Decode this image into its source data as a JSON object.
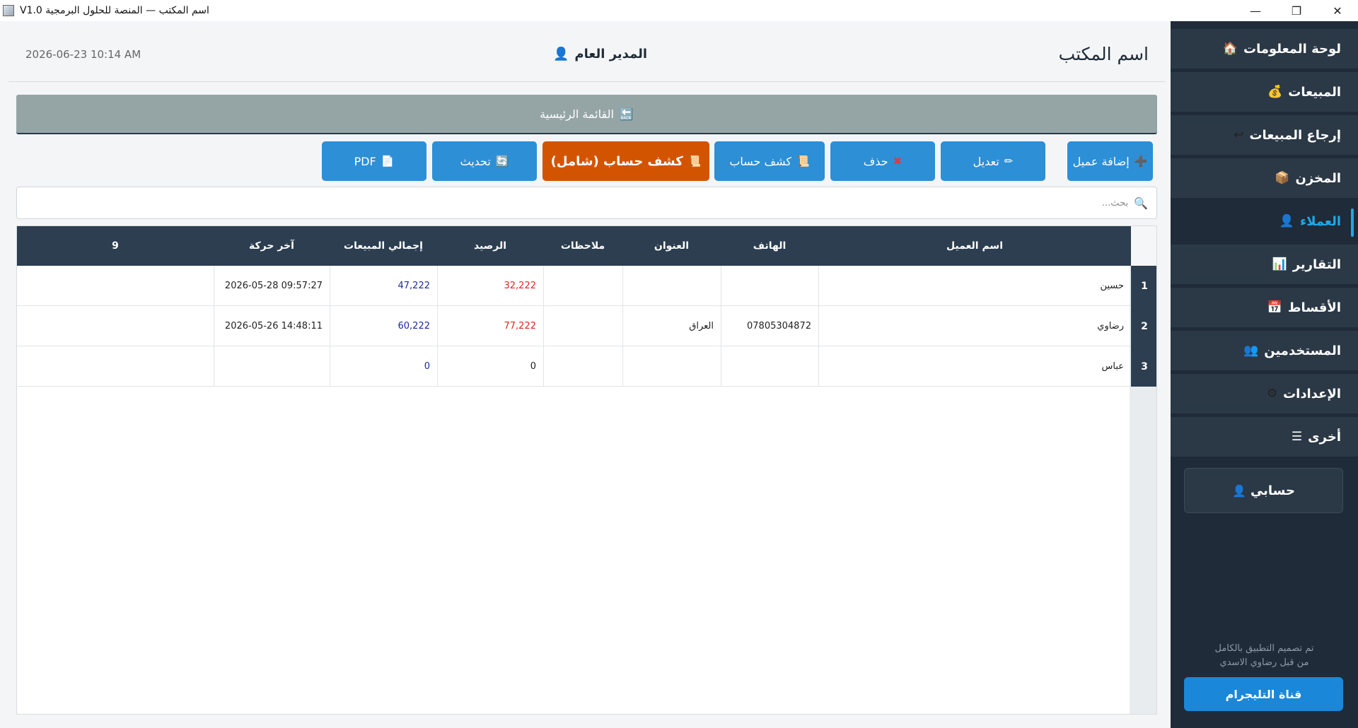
{
  "window": {
    "title": "V1.0 اسم المكتب — المنصة للحلول البرمجية",
    "minimize": "—",
    "maximize": "❐",
    "close": "✕"
  },
  "header": {
    "office_name": "اسم المكتب",
    "manager": "المدير العام",
    "manager_icon": "👤",
    "datetime": "2026-06-23  10:14 AM"
  },
  "sidebar": {
    "items": [
      {
        "label": "لوحة المعلومات",
        "icon": "🏠"
      },
      {
        "label": "المبيعات",
        "icon": "💰"
      },
      {
        "label": "إرجاع المبيعات",
        "icon": "↩"
      },
      {
        "label": "المخزن",
        "icon": "📦"
      },
      {
        "label": "العملاء",
        "icon": "👤"
      },
      {
        "label": "التقارير",
        "icon": "📊"
      },
      {
        "label": "الأقساط",
        "icon": "📅"
      },
      {
        "label": "المستخدمين",
        "icon": "👥"
      },
      {
        "label": "الإعدادات",
        "icon": "⚙"
      },
      {
        "label": "أخرى",
        "icon": "☰"
      }
    ],
    "my_account": "حسابي",
    "my_account_icon": "👤",
    "credit_line1": "تم تصميم التطبيق بالكامل",
    "credit_line2": "من قبل رضاوي الاسدي",
    "telegram": "قناة التليجرام"
  },
  "main_menu": {
    "label": "القائمة الرئيسية",
    "icon": "🔙"
  },
  "toolbar": {
    "add": {
      "label": "إضافة عميل",
      "icon": "➕"
    },
    "edit": {
      "label": "تعديل",
      "icon": "✏"
    },
    "delete": {
      "label": "حذف",
      "icon": "✖"
    },
    "statement": {
      "label": "كشف حساب",
      "icon": "📜"
    },
    "statement_full": {
      "label": "كشف حساب (شامل)",
      "icon": "📜"
    },
    "refresh": {
      "label": "تحديث",
      "icon": "🔄"
    },
    "pdf": {
      "label": "PDF",
      "icon": "📄"
    }
  },
  "search": {
    "placeholder": "بحث...",
    "value": ""
  },
  "table": {
    "columns": [
      "اسم العميل",
      "الهاتف",
      "العنوان",
      "ملاحظات",
      "الرصيد",
      "إجمالي المبيعات",
      "آخر حركة",
      "9"
    ],
    "rows": [
      {
        "num": "1",
        "name": "حسين",
        "phone": "",
        "address": "",
        "notes": "",
        "balance": "32,222",
        "total_sales": "47,222",
        "last_activity": "2026-05-28 09:57:27"
      },
      {
        "num": "2",
        "name": "رضاوي",
        "phone": "07805304872",
        "address": "العراق",
        "notes": "",
        "balance": "77,222",
        "total_sales": "60,222",
        "last_activity": "2026-05-26 14:48:11"
      },
      {
        "num": "3",
        "name": "عباس",
        "phone": "",
        "address": "",
        "notes": "",
        "balance": "0",
        "total_sales": "0",
        "last_activity": ""
      }
    ]
  }
}
